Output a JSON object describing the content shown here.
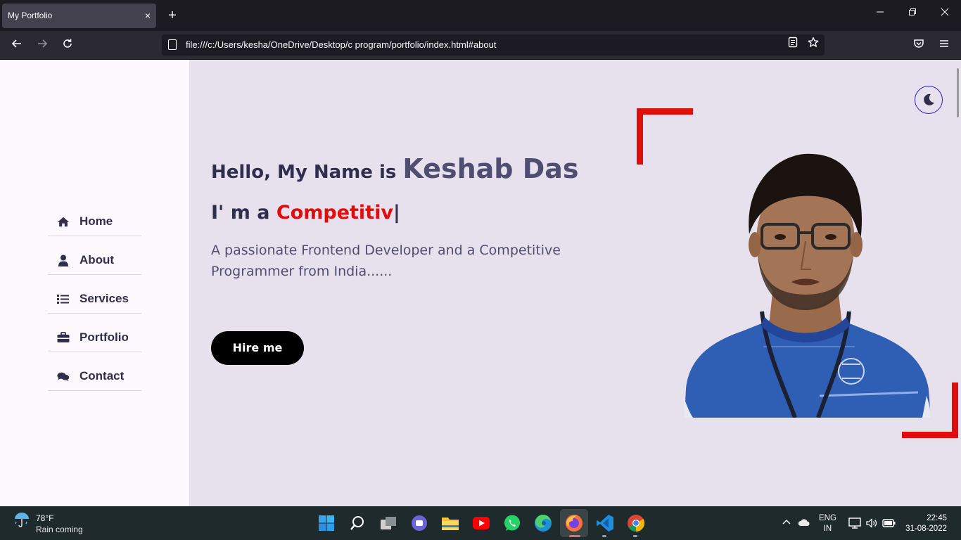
{
  "browser": {
    "tab_title": "My Portfolio",
    "tab_close": "×",
    "new_tab": "+",
    "url": "file:///c:/Users/kesha/OneDrive/Desktop/c program/portfolio/index.html#about"
  },
  "sidebar": {
    "items": [
      {
        "label": "Home",
        "icon": "home-icon"
      },
      {
        "label": "About",
        "icon": "user-icon"
      },
      {
        "label": "Services",
        "icon": "list-icon"
      },
      {
        "label": "Portfolio",
        "icon": "briefcase-icon"
      },
      {
        "label": "Contact",
        "icon": "comments-icon"
      }
    ]
  },
  "hero": {
    "greeting": "Hello, My Name is ",
    "name": "Keshab Das",
    "im_prefix": "I' m a ",
    "typed": "Competitiv",
    "cursor": "|",
    "description": "A passionate Frontend Developer and a Competitive Programmer from India......",
    "hire_label": "Hire me"
  },
  "colors": {
    "accent": "#e10c0c",
    "text_dark": "#302e4d",
    "text_muted": "#504e70",
    "page_bg": "#e6e1ec",
    "sidebar_bg": "#fdf9ff"
  },
  "taskbar": {
    "weather_temp": "78°F",
    "weather_status": "Rain coming",
    "lang_top": "ENG",
    "lang_bottom": "IN",
    "time": "22:45",
    "date": "31-08-2022"
  }
}
